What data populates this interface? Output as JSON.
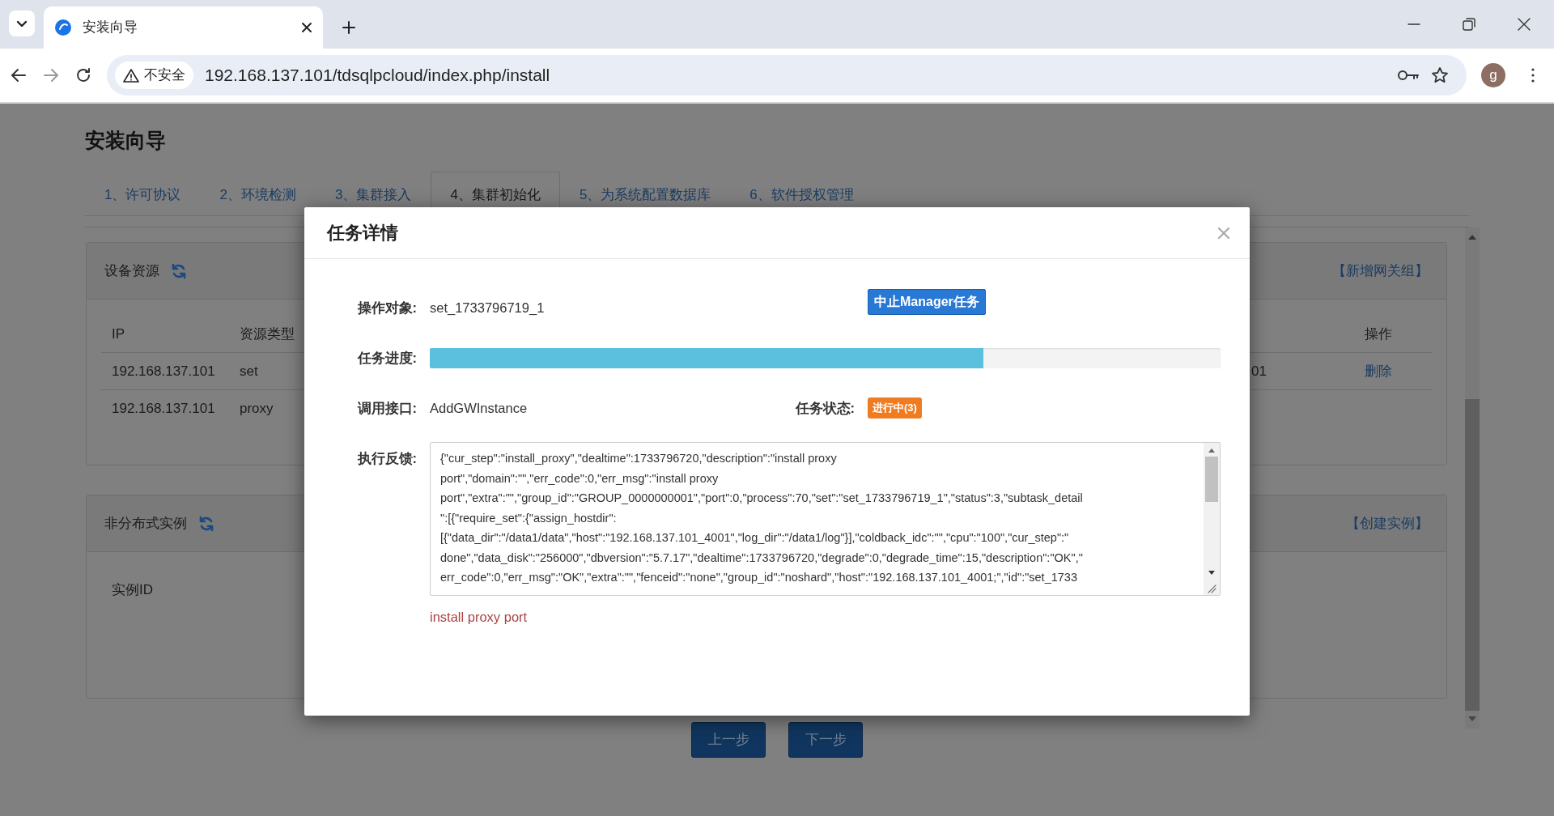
{
  "browser": {
    "tab_title": "安装向导",
    "security_label": "不安全",
    "url": "192.168.137.101/tdsqlpcloud/index.php/install",
    "profile_initial": "g"
  },
  "page": {
    "title": "安装向导",
    "steps": [
      {
        "label": "1、许可协议",
        "selected": false
      },
      {
        "label": "2、环境检测",
        "selected": false
      },
      {
        "label": "3、集群接入",
        "selected": false
      },
      {
        "label": "4、集群初始化",
        "selected": true
      },
      {
        "label": "5、为系统配置数据库",
        "selected": false
      },
      {
        "label": "6、软件授权管理",
        "selected": false
      }
    ],
    "device_panel": {
      "title": "设备资源",
      "action": "【新增网关组】",
      "columns": [
        "IP",
        "资源类型",
        "操作"
      ],
      "rows": [
        {
          "ip": "192.168.137.101",
          "type": "set",
          "column_3": "01",
          "action": "删除"
        },
        {
          "ip": "192.168.137.101",
          "type": "proxy"
        }
      ]
    },
    "instance_panel": {
      "title": "非分布式实例",
      "action": "【创建实例】",
      "columns": [
        "实例ID"
      ]
    },
    "nav_buttons": [
      "上一步",
      "下一步"
    ]
  },
  "modal": {
    "title": "任务详情",
    "target_label": "操作对象:",
    "target": "set_1733796719_1",
    "stop_button": "中止Manager任务",
    "progress_label": "任务进度:",
    "level": 0.7,
    "api_label": "调用接口:",
    "api": "AddGWInstance",
    "status_label": "任务状态:",
    "status": "进行中(3)",
    "feedback_label": "执行反馈:",
    "feedback_lines": [
      "{\"cur_step\":\"install_proxy\",\"dealtime\":1733796720,\"description\":\"install proxy",
      "port\",\"domain\":\"\",\"err_code\":0,\"err_msg\":\"install proxy",
      "port\",\"extra\":\"\",\"group_id\":\"GROUP_0000000001\",\"port\":0,\"process\":70,\"set\":\"set_1733796719_1\",\"status\":3,\"subtask_detail",
      "\":[{\"require_set\":{\"assign_hostdir\":",
      "[{\"data_dir\":\"/data1/data\",\"host\":\"192.168.137.101_4001\",\"log_dir\":\"/data1/log\"}],\"coldback_idc\":\"\",\"cpu\":\"100\",\"cur_step\":\"",
      "done\",\"data_disk\":\"256000\",\"dbversion\":\"5.7.17\",\"dealtime\":1733796720,\"degrade\":0,\"degrade_time\":15,\"description\":\"OK\",\"",
      "err_code\":0,\"err_msg\":\"OK\",\"extra\":\"\",\"fenceid\":\"none\",\"group_id\":\"noshard\",\"host\":\"192.168.137.101_4001;\",\"id\":\"set_1733"
    ],
    "message": "install proxy port"
  }
}
